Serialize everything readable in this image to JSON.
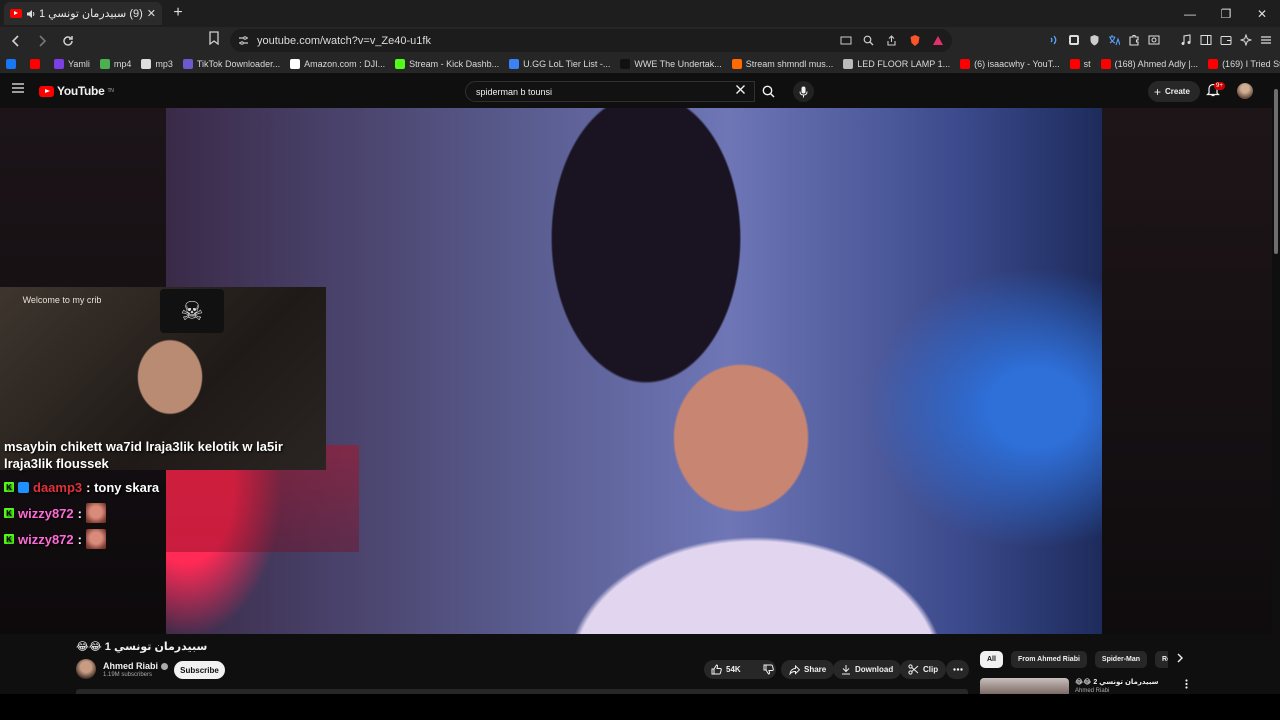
{
  "browser": {
    "tab_title": "(9) سبيدرمان تونسي 1 😂😂",
    "new_tab": "+",
    "url": "youtube.com/watch?v=v_Ze40-u1fk",
    "window_controls": [
      "—",
      "❐",
      "✕"
    ],
    "bookmarks": [
      {
        "label": "",
        "color": "#1877f2"
      },
      {
        "label": "",
        "color": "#ff0000"
      },
      {
        "label": "Yamli",
        "color": "#7b3fe4"
      },
      {
        "label": "mp4",
        "color": "#4caf50"
      },
      {
        "label": "mp3",
        "color": "#dddddd"
      },
      {
        "label": "TikTok Downloader...",
        "color": "#6a5acd"
      },
      {
        "label": "Amazon.com : DJI...",
        "color": "#ffffff"
      },
      {
        "label": "Stream - Kick Dashb...",
        "color": "#53fc18"
      },
      {
        "label": "U.GG LoL Tier List -...",
        "color": "#3b82f6"
      },
      {
        "label": "WWE The Undertak...",
        "color": "#111111"
      },
      {
        "label": "Stream shmndl mus...",
        "color": "#ff6a00"
      },
      {
        "label": "LED FLOOR LAMP 1...",
        "color": "#bbbbbb"
      },
      {
        "label": "(6) isaacwhy - YouT...",
        "color": "#ff0000"
      },
      {
        "label": "st",
        "color": "#ff0000"
      },
      {
        "label": "(168) Ahmed Adly |...",
        "color": "#ff0000"
      },
      {
        "label": "(169) I Tried Streami...",
        "color": "#ff0000"
      }
    ]
  },
  "youtube": {
    "logo_text": "YouTube",
    "logo_sup": "TN",
    "search_value": "spiderman b tounsi",
    "create_label": "Create",
    "notif_badge": "9+"
  },
  "overlay": {
    "webcam_sign": "Welcome to my crib",
    "first_message": "msaybin chikett wa7id lrajа3lik kelotik w la5ir lrajа3lik floussek",
    "messages": [
      {
        "user": "daamp3",
        "text": ": tony skara",
        "user_color": "red",
        "badges": [
          "kick",
          "blue"
        ],
        "emote": false
      },
      {
        "user": "wizzy872",
        "text": ":",
        "user_color": "pink",
        "badges": [
          "kick"
        ],
        "emote": true
      },
      {
        "user": "wizzy872",
        "text": ":",
        "user_color": "pink",
        "badges": [
          "kick"
        ],
        "emote": true
      }
    ]
  },
  "video": {
    "title": "سبيدرمان تونسي 1 😂😂",
    "channel": "Ahmed Riabi",
    "subscribers": "1.19M subscribers",
    "subscribe_label": "Subscribe",
    "likes": "54K",
    "share_label": "Share",
    "download_label": "Download",
    "clip_label": "Clip"
  },
  "sidebar": {
    "chips": [
      "All",
      "From Ahmed Riabi",
      "Spider-Man",
      "Related"
    ],
    "active_chip": "All",
    "rec_title": "سبيدرمان تونسي 2 😂😂",
    "rec_channel": "Ahmed Riabi"
  }
}
